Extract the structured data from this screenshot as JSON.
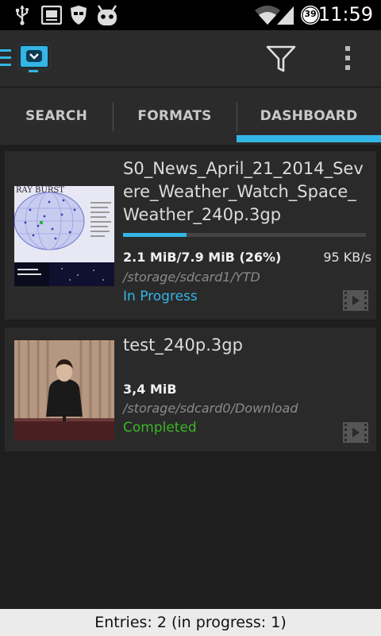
{
  "status_bar": {
    "time": "11:59",
    "battery_level": "39",
    "icons": [
      "usb-icon",
      "screenshot-icon",
      "incognito-icon",
      "android-debug-icon",
      "wifi-icon",
      "signal-icon",
      "battery-icon"
    ]
  },
  "action_bar": {
    "logo_icon": "video-download-logo-icon",
    "filter_icon": "filter-icon",
    "overflow_icon": "overflow-menu-icon"
  },
  "tabs": [
    {
      "label": "SEARCH",
      "selected": false
    },
    {
      "label": "FORMATS",
      "selected": false
    },
    {
      "label": "DASHBOARD",
      "selected": true
    }
  ],
  "downloads": [
    {
      "title": "S0_News_April_21_2014_Severe_Weather_Watch_Space_Weather_240p.3gp",
      "title_lines": [
        "S0_News_April_21_2014_Sev",
        "ere_Weather_Watch_Space_",
        "Weather_240p.3gp"
      ],
      "thumbnail_text": "RAY BURST",
      "progress_fraction": 0.26,
      "size": "2.1 MiB/7.9 MiB (26%)",
      "speed": "95 KB/s",
      "path": "/storage/sdcard1/YTD",
      "status": "In Progress",
      "status_color": "#33b5e5",
      "type_icon": "video-file-icon"
    },
    {
      "title": "test_240p.3gp",
      "title_lines": [
        "test_240p.3gp"
      ],
      "size": "3,4 MiB",
      "path": "/storage/sdcard0/Download",
      "status": "Completed",
      "status_color": "#3db526",
      "type_icon": "video-file-icon"
    }
  ],
  "footer": {
    "summary": "Entries: 2 (in progress: 1)"
  },
  "colors": {
    "accent": "#33b5e5",
    "background": "#1e1e1e",
    "card": "#2a2a2a"
  }
}
